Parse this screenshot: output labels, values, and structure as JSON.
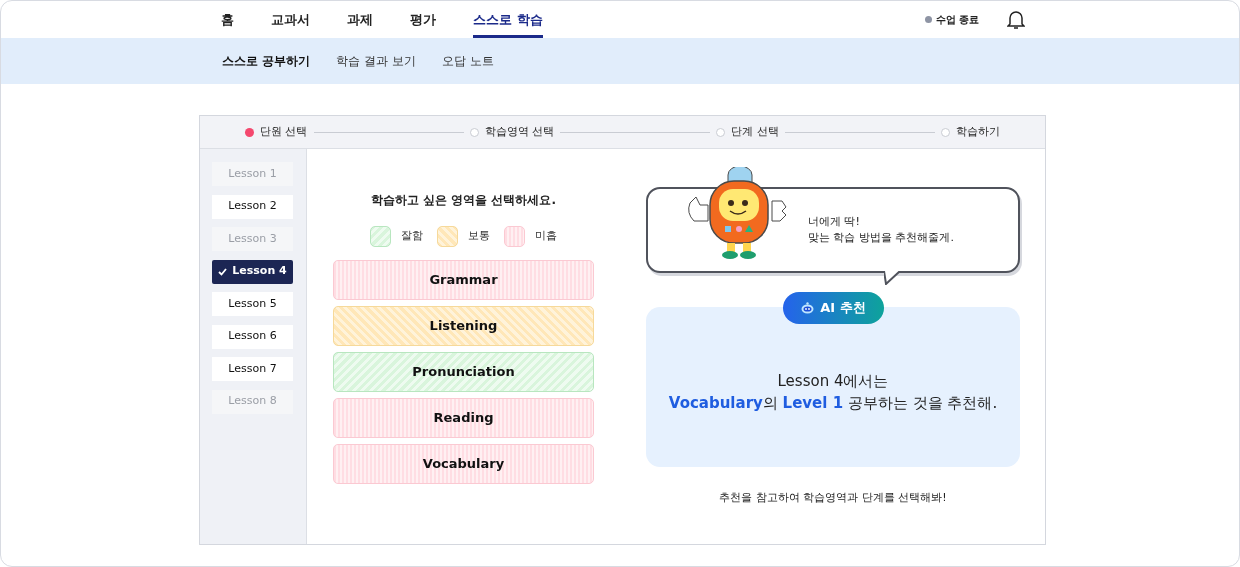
{
  "nav": {
    "tabs": [
      {
        "label": "홈",
        "selected": false
      },
      {
        "label": "교과서",
        "selected": false
      },
      {
        "label": "과제",
        "selected": false
      },
      {
        "label": "평가",
        "selected": false
      },
      {
        "label": "스스로 학습",
        "selected": true
      }
    ],
    "class_status": "수업 종료"
  },
  "subnav": [
    {
      "label": "스스로 공부하기",
      "selected": true
    },
    {
      "label": "학습 결과 보기",
      "selected": false
    },
    {
      "label": "오답 노트",
      "selected": false
    }
  ],
  "steps": [
    {
      "label": "단원 선택",
      "selected": true
    },
    {
      "label": "학습영역 선택",
      "selected": false
    },
    {
      "label": "단계 선택",
      "selected": false
    },
    {
      "label": "학습하기",
      "selected": false
    }
  ],
  "lessons": [
    {
      "label": "Lesson 1",
      "selected": false,
      "disabled": true
    },
    {
      "label": "Lesson 2",
      "selected": false,
      "disabled": false
    },
    {
      "label": "Lesson 3",
      "selected": false,
      "disabled": true
    },
    {
      "label": "Lesson 4",
      "selected": true,
      "disabled": false
    },
    {
      "label": "Lesson 5",
      "selected": false,
      "disabled": false
    },
    {
      "label": "Lesson 6",
      "selected": false,
      "disabled": false
    },
    {
      "label": "Lesson 7",
      "selected": false,
      "disabled": false
    },
    {
      "label": "Lesson 8",
      "selected": false,
      "disabled": true
    }
  ],
  "area_prompt": "학습하고 싶은 영역을 선택하세요.",
  "legend": [
    {
      "kind": "good",
      "label": "잘함"
    },
    {
      "kind": "normal",
      "label": "보통"
    },
    {
      "kind": "weak",
      "label": "미흡"
    }
  ],
  "areas": [
    {
      "label": "Grammar",
      "kind": "weak"
    },
    {
      "label": "Listening",
      "kind": "normal"
    },
    {
      "label": "Pronunciation",
      "kind": "good"
    },
    {
      "label": "Reading",
      "kind": "weak"
    },
    {
      "label": "Vocabulary",
      "kind": "weak"
    }
  ],
  "speech_bubble": [
    "너에게 딱!",
    "맞는 학습 방법을 추천해줄게."
  ],
  "ai_badge": "AI 추천",
  "recommendation": {
    "line_1": "Lesson 4에서는",
    "line_2": [
      {
        "text": "Vocabulary",
        "highlight": true
      },
      {
        "text": "의 ",
        "highlight": false
      },
      {
        "text": "Level 1",
        "highlight": true
      },
      {
        "text": " 공부하는 것을 추천해.",
        "highlight": false
      }
    ]
  },
  "footer_hint": "추천을 참고하여 학습영역과 단계를 선택해봐!"
}
